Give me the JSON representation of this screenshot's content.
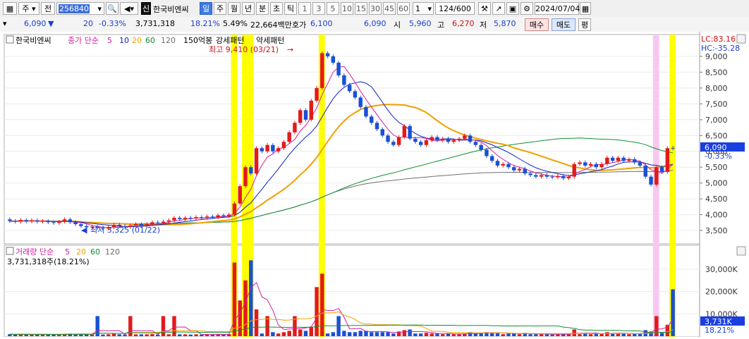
{
  "toolbar": {
    "type_btn": "주",
    "prev_btn": "전",
    "code": "256840",
    "stock_name": "한국비엔씨",
    "new_badge": "신",
    "periods": [
      "일",
      "주",
      "월",
      "년",
      "분",
      "초",
      "틱"
    ],
    "period_nums": [
      "1",
      "3",
      "5",
      "10",
      "15",
      "30",
      "45",
      "60"
    ],
    "interval": "1",
    "count": "124/600",
    "date": "2024/07/04"
  },
  "quote": {
    "price": "6,090",
    "down_marker": "▼",
    "change": "20",
    "change_pct": "-0.33%",
    "volume": "3,731,318",
    "vol_rate": "18.21%",
    "turnover_rate": "5.49%",
    "amount": "22,664백만",
    "ask_label": "호가",
    "ask1": "6,100",
    "bid1": "6,090",
    "open_label": "시",
    "open": "5,960",
    "high_label": "고",
    "high": "6,270",
    "low_label": "저",
    "low": "5,870",
    "buy_btn": "매수",
    "sell_btn": "매도",
    "eval_btn": "평"
  },
  "price_panel": {
    "legend_name": "한국비엔씨",
    "legend_ma_label": "종가 단순",
    "legend_ma_periods": [
      "5",
      "10",
      "20",
      "60",
      "120"
    ],
    "legend_ma_colors": [
      "#d020a0",
      "#1020c0",
      "#f0a000",
      "#109030",
      "#707070"
    ],
    "legend_extra": "150억봉",
    "legend_pattern_strong": "강세패턴",
    "legend_pattern_weak": "약세패턴",
    "max_label": "최고 9,410 (03/21)",
    "min_label": "최저 3,325 (01/22)",
    "lc": "LC:83.16",
    "hc": "HC:-35.28",
    "price_tag": "6,090",
    "price_tag_pct": "-0.33%",
    "y_ticks": [
      "9,000",
      "8,500",
      "8,000",
      "7,500",
      "7,000",
      "6,500",
      "6,000",
      "5,500",
      "5,000",
      "4,500",
      "4,000",
      "3,500"
    ]
  },
  "volume_panel": {
    "legend_label": "거래량 단순",
    "legend_periods": [
      "5",
      "20",
      "60",
      "120"
    ],
    "volume_text": "3,731,318주(18.21%)",
    "vol_tag": "3,731K",
    "vol_tag_pct": "18.21%",
    "y_ticks": [
      "30,000K",
      "20,000K",
      "10,000K"
    ]
  },
  "chart_data": {
    "type": "candlestick",
    "price_range": [
      3100,
      9600
    ],
    "volume_range": [
      0,
      36000
    ],
    "candles_approx": [
      {
        "o": 3850,
        "c": 3800
      },
      {
        "o": 3800,
        "c": 3780
      },
      {
        "o": 3780,
        "c": 3830
      },
      {
        "o": 3830,
        "c": 3790
      },
      {
        "o": 3790,
        "c": 3820
      },
      {
        "o": 3820,
        "c": 3780
      },
      {
        "o": 3780,
        "c": 3800
      },
      {
        "o": 3800,
        "c": 3760
      },
      {
        "o": 3760,
        "c": 3740
      },
      {
        "o": 3740,
        "c": 3780
      },
      {
        "o": 3780,
        "c": 3850
      },
      {
        "o": 3850,
        "c": 3760
      },
      {
        "o": 3760,
        "c": 3700
      },
      {
        "o": 3700,
        "c": 3640
      },
      {
        "o": 3640,
        "c": 3600
      },
      {
        "o": 3600,
        "c": 3620
      },
      {
        "o": 3620,
        "c": 3580
      },
      {
        "o": 3580,
        "c": 3560
      },
      {
        "o": 3560,
        "c": 3600
      },
      {
        "o": 3600,
        "c": 3680
      },
      {
        "o": 3680,
        "c": 3640
      },
      {
        "o": 3640,
        "c": 3620
      },
      {
        "o": 3620,
        "c": 3660
      },
      {
        "o": 3660,
        "c": 3700
      },
      {
        "o": 3700,
        "c": 3660
      },
      {
        "o": 3660,
        "c": 3700
      },
      {
        "o": 3700,
        "c": 3760
      },
      {
        "o": 3760,
        "c": 3740
      },
      {
        "o": 3740,
        "c": 3780
      },
      {
        "o": 3780,
        "c": 3820
      },
      {
        "o": 3820,
        "c": 3900
      },
      {
        "o": 3900,
        "c": 3860
      },
      {
        "o": 3860,
        "c": 3900
      },
      {
        "o": 3900,
        "c": 3880
      },
      {
        "o": 3880,
        "c": 3920
      },
      {
        "o": 3920,
        "c": 3900
      },
      {
        "o": 3900,
        "c": 3940
      },
      {
        "o": 3940,
        "c": 3920
      },
      {
        "o": 3920,
        "c": 3980
      },
      {
        "o": 3980,
        "c": 3950
      },
      {
        "o": 3950,
        "c": 4000
      },
      {
        "o": 4000,
        "c": 4350
      },
      {
        "o": 4350,
        "c": 4900
      },
      {
        "o": 4900,
        "c": 5500
      },
      {
        "o": 5500,
        "c": 5300
      },
      {
        "o": 5300,
        "c": 6100
      },
      {
        "o": 6100,
        "c": 6000
      },
      {
        "o": 6000,
        "c": 6200
      },
      {
        "o": 6200,
        "c": 6000
      },
      {
        "o": 6000,
        "c": 6100
      },
      {
        "o": 6100,
        "c": 6300
      },
      {
        "o": 6300,
        "c": 6600
      },
      {
        "o": 6600,
        "c": 6900
      },
      {
        "o": 6900,
        "c": 7300
      },
      {
        "o": 7300,
        "c": 7000
      },
      {
        "o": 7000,
        "c": 7600
      },
      {
        "o": 7600,
        "c": 8000
      },
      {
        "o": 8000,
        "c": 9100
      },
      {
        "o": 9100,
        "c": 9000
      },
      {
        "o": 9000,
        "c": 8800
      },
      {
        "o": 8800,
        "c": 8400
      },
      {
        "o": 8400,
        "c": 8100
      },
      {
        "o": 8100,
        "c": 7900
      },
      {
        "o": 7900,
        "c": 7700
      },
      {
        "o": 7700,
        "c": 7400
      },
      {
        "o": 7400,
        "c": 7100
      },
      {
        "o": 7100,
        "c": 6900
      },
      {
        "o": 6900,
        "c": 6700
      },
      {
        "o": 6700,
        "c": 6500
      },
      {
        "o": 6500,
        "c": 6300
      },
      {
        "o": 6300,
        "c": 6200
      },
      {
        "o": 6200,
        "c": 6450
      },
      {
        "o": 6450,
        "c": 6800
      },
      {
        "o": 6800,
        "c": 6400
      },
      {
        "o": 6400,
        "c": 6300
      },
      {
        "o": 6300,
        "c": 6200
      },
      {
        "o": 6200,
        "c": 6350
      },
      {
        "o": 6350,
        "c": 6450
      },
      {
        "o": 6450,
        "c": 6350
      },
      {
        "o": 6350,
        "c": 6400
      },
      {
        "o": 6400,
        "c": 6300
      },
      {
        "o": 6300,
        "c": 6350
      },
      {
        "o": 6350,
        "c": 6400
      },
      {
        "o": 6400,
        "c": 6500
      },
      {
        "o": 6500,
        "c": 6300
      },
      {
        "o": 6300,
        "c": 6200
      },
      {
        "o": 6200,
        "c": 6050
      },
      {
        "o": 6050,
        "c": 5850
      },
      {
        "o": 5850,
        "c": 5700
      },
      {
        "o": 5700,
        "c": 5550
      },
      {
        "o": 5550,
        "c": 5600
      },
      {
        "o": 5600,
        "c": 5500
      },
      {
        "o": 5500,
        "c": 5400
      },
      {
        "o": 5400,
        "c": 5450
      },
      {
        "o": 5450,
        "c": 5300
      },
      {
        "o": 5300,
        "c": 5250
      },
      {
        "o": 5250,
        "c": 5200
      },
      {
        "o": 5200,
        "c": 5250
      },
      {
        "o": 5250,
        "c": 5200
      },
      {
        "o": 5200,
        "c": 5180
      },
      {
        "o": 5180,
        "c": 5220
      },
      {
        "o": 5220,
        "c": 5150
      },
      {
        "o": 5150,
        "c": 5200
      },
      {
        "o": 5200,
        "c": 5600
      },
      {
        "o": 5600,
        "c": 5650
      },
      {
        "o": 5650,
        "c": 5550
      },
      {
        "o": 5550,
        "c": 5600
      },
      {
        "o": 5600,
        "c": 5500
      },
      {
        "o": 5500,
        "c": 5600
      },
      {
        "o": 5600,
        "c": 5800
      },
      {
        "o": 5800,
        "c": 5700
      },
      {
        "o": 5700,
        "c": 5800
      },
      {
        "o": 5800,
        "c": 5700
      },
      {
        "o": 5700,
        "c": 5750
      },
      {
        "o": 5750,
        "c": 5650
      },
      {
        "o": 5650,
        "c": 5550
      },
      {
        "o": 5550,
        "c": 5200
      },
      {
        "o": 5200,
        "c": 4950
      },
      {
        "o": 4950,
        "c": 5500
      },
      {
        "o": 5500,
        "c": 5350
      },
      {
        "o": 5350,
        "c": 6100
      },
      {
        "o": 6110,
        "c": 6090
      }
    ]
  },
  "colors": {
    "up": "#e31a1a",
    "down": "#1a50d6",
    "highlight_strong": "#ffff00",
    "highlight_weak": "#f8c8f0",
    "price_tag_bg": "#1a3fe0"
  }
}
